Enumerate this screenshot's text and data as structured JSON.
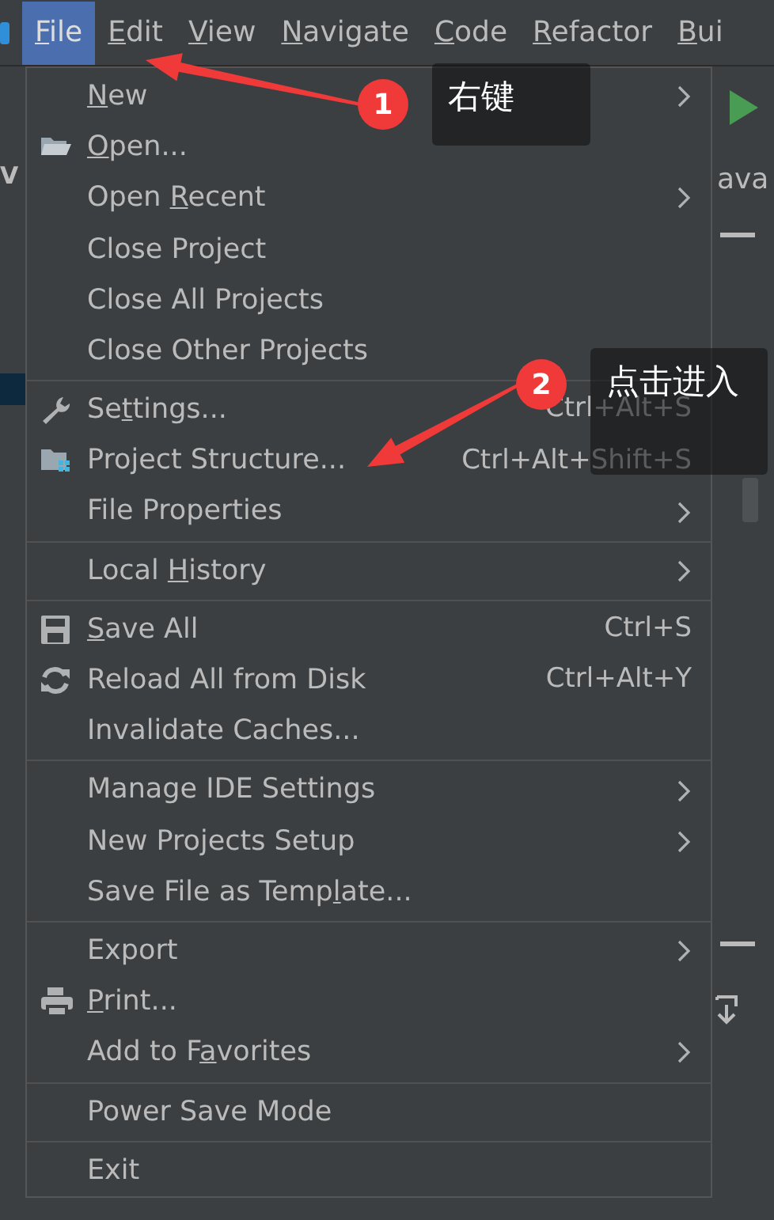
{
  "menubar": [
    {
      "mnemonic": "F",
      "after": "ile",
      "selected": true
    },
    {
      "mnemonic": "E",
      "after": "dit",
      "selected": false
    },
    {
      "mnemonic": "V",
      "after": "iew",
      "selected": false
    },
    {
      "mnemonic": "N",
      "after": "avigate",
      "selected": false
    },
    {
      "mnemonic": "C",
      "after": "ode",
      "selected": false
    },
    {
      "mnemonic": "R",
      "after": "efactor",
      "selected": false
    },
    {
      "mnemonic": "B",
      "after": "ui",
      "selected": false
    }
  ],
  "background": {
    "left_fragment": "V",
    "tab_fragment": "ava"
  },
  "file_menu": {
    "groups": [
      [
        {
          "kind": "plain",
          "mnemonic": "N",
          "after": "ew",
          "submenu": true
        },
        {
          "kind": "folder",
          "mnemonic": "O",
          "after": "pen...",
          "submenu": false
        },
        {
          "kind": "plain",
          "before": "Open ",
          "mnemonic": "R",
          "after": "ecent",
          "submenu": true
        },
        {
          "kind": "plain",
          "before": "Close Project",
          "submenu": false
        },
        {
          "kind": "plain",
          "before": "Close All Projects",
          "submenu": false
        },
        {
          "kind": "plain",
          "before": "Close Other Projects",
          "submenu": false
        }
      ],
      [
        {
          "kind": "wrench",
          "before": "Se",
          "mnemonic": "t",
          "after": "tings...",
          "shortcut": "Ctrl+Alt+S",
          "submenu": false
        },
        {
          "kind": "structure",
          "before": "Project Structure...",
          "shortcut": "Ctrl+Alt+Shift+S",
          "submenu": false
        },
        {
          "kind": "plain",
          "before": "File Properties",
          "submenu": true
        }
      ],
      [
        {
          "kind": "plain",
          "before": "Local ",
          "mnemonic": "H",
          "after": "istory",
          "submenu": true
        }
      ],
      [
        {
          "kind": "disk",
          "mnemonic": "S",
          "after": "ave All",
          "shortcut": "Ctrl+S",
          "submenu": false
        },
        {
          "kind": "reload",
          "before": "Reload All from Disk",
          "shortcut": "Ctrl+Alt+Y",
          "submenu": false
        },
        {
          "kind": "plain",
          "before": "Invalidate Caches...",
          "submenu": false
        }
      ],
      [
        {
          "kind": "plain",
          "before": "Manage IDE Settings",
          "submenu": true
        },
        {
          "kind": "plain",
          "before": "New Projects Setup",
          "submenu": true
        },
        {
          "kind": "plain",
          "before": "Save File as Temp",
          "mnemonic": "l",
          "after": "ate...",
          "submenu": false
        }
      ],
      [
        {
          "kind": "plain",
          "before": "Export",
          "submenu": true
        },
        {
          "kind": "printer",
          "mnemonic": "P",
          "after": "rint...",
          "submenu": false
        },
        {
          "kind": "plain",
          "before": "Add to F",
          "mnemonic": "a",
          "after": "vorites",
          "submenu": true
        }
      ],
      [
        {
          "kind": "plain",
          "before": "Power Save Mode",
          "submenu": false
        }
      ],
      [
        {
          "kind": "plain",
          "before": "Exit",
          "submenu": false
        }
      ]
    ]
  },
  "annotations": [
    {
      "number": "1",
      "note": "右键"
    },
    {
      "number": "2",
      "note": "点击进入"
    }
  ]
}
